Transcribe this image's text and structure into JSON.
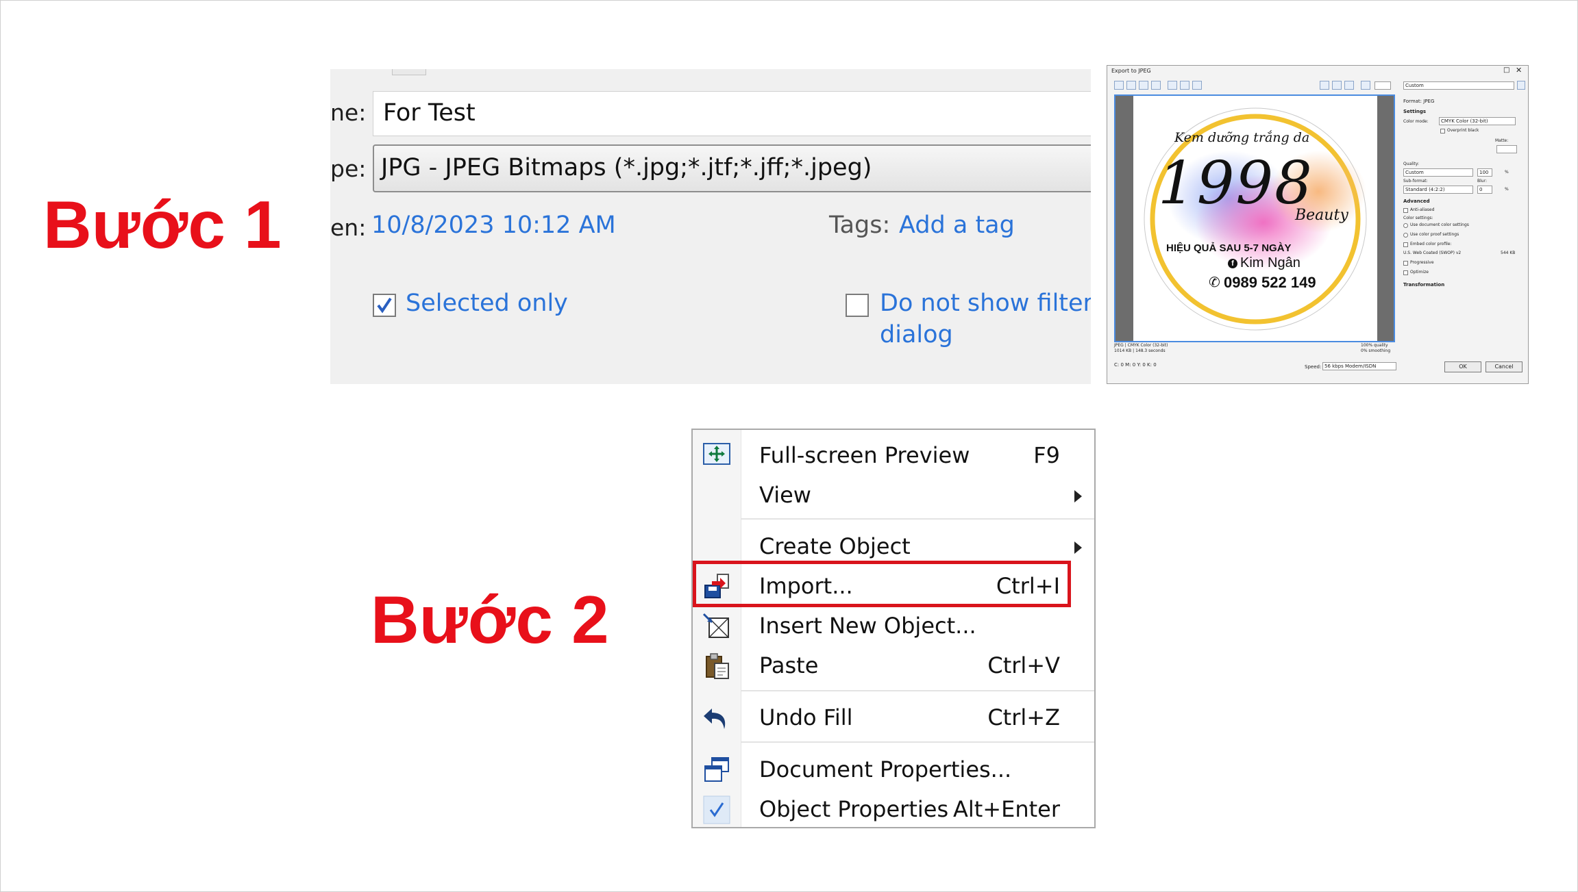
{
  "steps": {
    "step1": "Bước 1",
    "step2": "Bước 2"
  },
  "save_dialog": {
    "name_label": "ne:",
    "name_value": "For Test",
    "type_label": "pe:",
    "type_value": "JPG - JPEG Bitmaps (*.jpg;*.jtf;*.jff;*.jpeg)",
    "date_label": "en:",
    "date_value": "10/8/2023 10:12 AM",
    "tags_label": "Tags:",
    "tags_link": "Add a tag",
    "selected_only": "Selected only",
    "selected_only_checked": true,
    "no_filter_line1": "Do not show filter",
    "no_filter_line2": "dialog",
    "no_filter_checked": false
  },
  "export_dialog": {
    "title": "Export to JPEG",
    "preset": "Custom",
    "format_label": "Format: JPEG",
    "settings_header": "Settings",
    "color_mode_label": "Color mode:",
    "color_mode_value": "CMYK Color (32-bit)",
    "overprint_black": "Overprint black",
    "matte_label": "Matte:",
    "quality_label": "Quality:",
    "quality_preset": "Custom",
    "quality_value": "100",
    "quality_unit": "%",
    "subformat_label": "Sub-format:",
    "subformat_value": "Standard (4:2:2)",
    "blur_label": "Blur:",
    "blur_value": "0",
    "blur_unit": "%",
    "advanced_header": "Advanced",
    "anti_aliased": "Anti-aliased",
    "color_settings_label": "Color settings:",
    "use_doc_color": "Use document color settings",
    "use_proof_color": "Use color proof settings",
    "embed_profile": "Embed color profile:",
    "profile_name": "U.S. Web Coated (SWOP) v2",
    "profile_size": "544 KB",
    "progressive": "Progressive",
    "optimize": "Optimize",
    "transformation_header": "Transformation",
    "status_left": "JPEG  |  CMYK Color (32-bit)",
    "status_left2": "1014 KB  |  148.3 seconds",
    "status_right": "100% quality",
    "status_right2": "0% smoothing",
    "cmyk_readout": "C: 0     M: 0     Y: 0     K: 0",
    "speed_label": "Speed:",
    "speed_value": "56 kbps Modem/ISDN",
    "ok": "OK",
    "cancel": "Cancel",
    "preview": {
      "headline": "Kem dưỡng trắng da",
      "big_number": "1998",
      "script_word": "Beauty",
      "tagline": "HIỆU QUẢ SAU 5-7 NGÀY",
      "name": "Kim Ngân",
      "phone": "0989 522 149",
      "ring_color": "#f2c230"
    }
  },
  "context_menu": {
    "items": [
      {
        "label": "Full-screen Preview",
        "shortcut": "F9",
        "icon": "fullscreen-preview-icon"
      },
      {
        "label": "View",
        "shortcut": "",
        "icon": ""
      },
      {
        "label": "Create Object",
        "shortcut": "",
        "icon": ""
      },
      {
        "label": "Import...",
        "shortcut": "Ctrl+I",
        "icon": "import-icon"
      },
      {
        "label": "Insert New Object...",
        "shortcut": "",
        "icon": "insert-object-icon"
      },
      {
        "label": "Paste",
        "shortcut": "Ctrl+V",
        "icon": "paste-icon"
      },
      {
        "label": "Undo Fill",
        "shortcut": "Ctrl+Z",
        "icon": "undo-icon"
      },
      {
        "label": "Document Properties...",
        "shortcut": "",
        "icon": "document-properties-icon"
      },
      {
        "label": "Object Properties",
        "shortcut": "Alt+Enter",
        "icon": "checkmark-icon"
      }
    ],
    "highlight_color": "#d9141c"
  }
}
